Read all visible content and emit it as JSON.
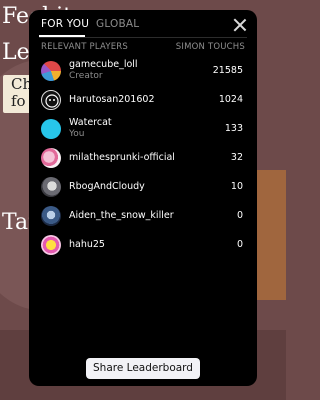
{
  "background": {
    "line1": "Feel it",
    "line2": "Le",
    "card_text": "Ch\nfo",
    "line3": "Tar"
  },
  "leaderboard": {
    "tabs": [
      {
        "label": "FOR YOU",
        "active": true
      },
      {
        "label": "GLOBAL",
        "active": false
      }
    ],
    "columns": {
      "left": "RELEVANT PLAYERS",
      "right": "SIMON TOUCHS"
    },
    "rows": [
      {
        "name": "gamecube_loll",
        "sub": "Creator",
        "score": "21585",
        "avatar": "colorful-art-avatar"
      },
      {
        "name": "Harutosan201602",
        "sub": "",
        "score": "1024",
        "avatar": "bw-face-avatar"
      },
      {
        "name": "Watercat",
        "sub": "You",
        "score": "133",
        "avatar": "cyan-avatar"
      },
      {
        "name": "milathesprunki-official",
        "sub": "",
        "score": "32",
        "avatar": "pink-character-avatar"
      },
      {
        "name": "RbogAndCloudy",
        "sub": "",
        "score": "10",
        "avatar": "gray-character-avatar"
      },
      {
        "name": "Aiden_the_snow_killer",
        "sub": "",
        "score": "0",
        "avatar": "blue-character-avatar"
      },
      {
        "name": "hahu25",
        "sub": "",
        "score": "0",
        "avatar": "yellow-character-avatar"
      }
    ],
    "share_label": "Share Leaderboard"
  }
}
